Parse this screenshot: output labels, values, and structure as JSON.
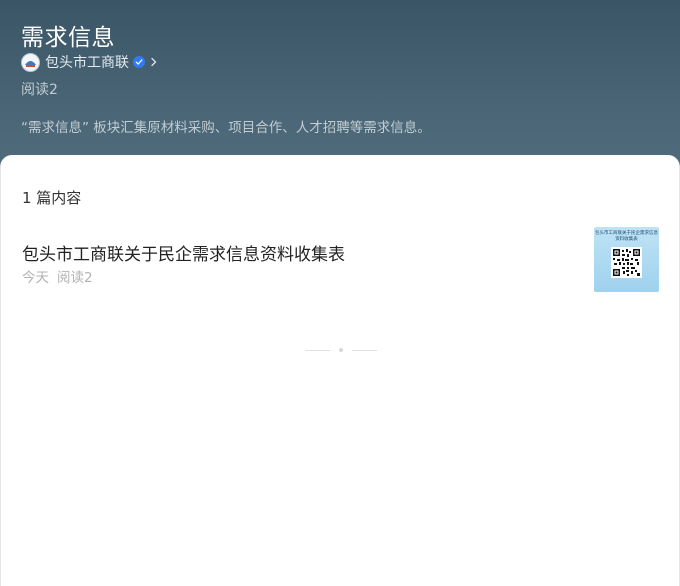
{
  "header": {
    "title": "需求信息",
    "account_name": "包头市工商联",
    "reads": "阅读2",
    "description": "“需求信息” 板块汇集原材料采购、项目合作、人才招聘等需求信息。"
  },
  "content": {
    "count": "1 篇内容",
    "articles": [
      {
        "title": "包头市工商联关于民企需求信息资料收集表",
        "date": "今天",
        "reads": "阅读2",
        "thumbnail": {
          "caption": "包头市工商联关于民企需求信息资料收集表"
        }
      }
    ]
  },
  "icons": {
    "avatar": "org-logo-icon",
    "verified": "verified-badge-icon",
    "chevron": "chevron-right-icon",
    "qr": "qr-code-icon"
  },
  "colors": {
    "header_top": "#3a5566",
    "header_bottom": "#516d7e",
    "verified_blue": "#2f7bf2",
    "thumbnail_bg": "#9fd1ee"
  }
}
